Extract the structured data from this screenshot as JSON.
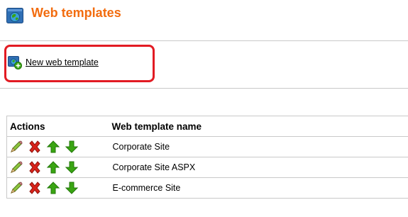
{
  "header": {
    "title": "Web templates",
    "icon": "web-template-globe-icon"
  },
  "actions": {
    "new_link_label": "New web template",
    "new_link_icon": "new-web-template-icon"
  },
  "table": {
    "columns": [
      "Actions",
      "Web template name"
    ],
    "action_icons": [
      "edit-pencil-icon",
      "delete-x-icon",
      "move-up-arrow-icon",
      "move-down-arrow-icon"
    ],
    "rows": [
      {
        "name": "Corporate Site"
      },
      {
        "name": "Corporate Site ASPX"
      },
      {
        "name": "E-commerce Site"
      }
    ]
  },
  "colors": {
    "title": "#f26c0f",
    "highlight_border": "#e21b23",
    "grid_line": "#c9c9c9",
    "arrow_green": "#3aa512",
    "delete_red": "#d8231a"
  }
}
